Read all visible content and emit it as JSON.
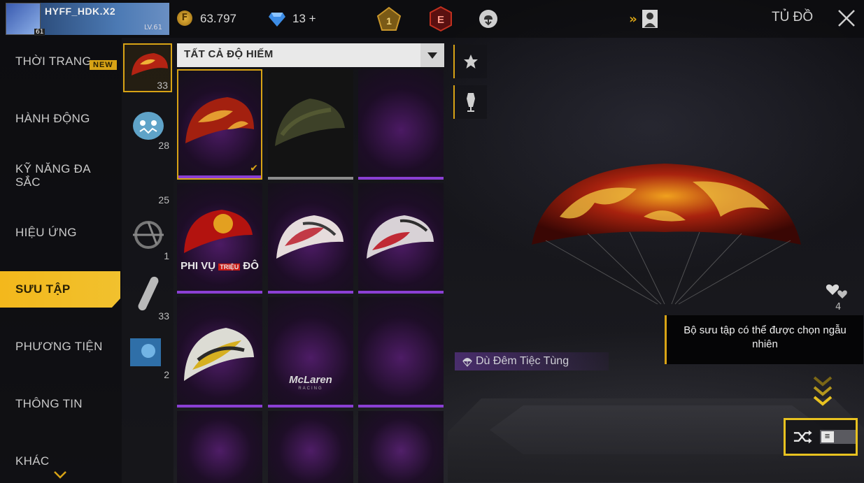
{
  "player": {
    "name": "HYFF_HDK.X2",
    "level_badge": "61",
    "level_text": "LV.61"
  },
  "currency": {
    "coins": "63.797",
    "coin_symbol": "F",
    "diamonds": "13",
    "diamond_plus": "+"
  },
  "topbar": {
    "rank_badge": "1",
    "elite_badge": "E",
    "title": "TỦ ĐỒ"
  },
  "sidebar": {
    "items": [
      {
        "label": "THỜI TRANG"
      },
      {
        "label": "HÀNH ĐỘNG"
      },
      {
        "label": "KỸ NĂNG ĐA SẮC"
      },
      {
        "label": "HIỆU ỨNG"
      },
      {
        "label": "SƯU TẬP"
      },
      {
        "label": "PHƯƠNG TIỆN"
      },
      {
        "label": "THÔNG TIN"
      },
      {
        "label": "KHÁC"
      }
    ],
    "new_badge": "NEW"
  },
  "categories": [
    {
      "name": "parachute-category",
      "count": "33"
    },
    {
      "name": "pet-category",
      "count": "28"
    },
    {
      "name": "weapon-skin-category",
      "count": "25"
    },
    {
      "name": "glider-category",
      "count": "1"
    },
    {
      "name": "board-category",
      "count": "33"
    },
    {
      "name": "banner-category",
      "count": "2"
    }
  ],
  "filter": {
    "label": "TẤT CẢ ĐỘ HIẾM"
  },
  "grid": {
    "phi_vu_text_a": "PHI VỤ",
    "phi_vu_text_b": "TRIỆU",
    "phi_vu_text_c": "ĐÔ",
    "mclaren_logo": "McLaren",
    "mclaren_sub": "RACING"
  },
  "preview": {
    "item_name": "Dù Đêm Tiệc Tùng",
    "tooltip": "Bộ sưu tập có thể được chọn ngẫu nhiên",
    "emote_count": "4"
  },
  "colors": {
    "accent": "#d8a315",
    "rarity_purple": "#8a3fd3"
  }
}
